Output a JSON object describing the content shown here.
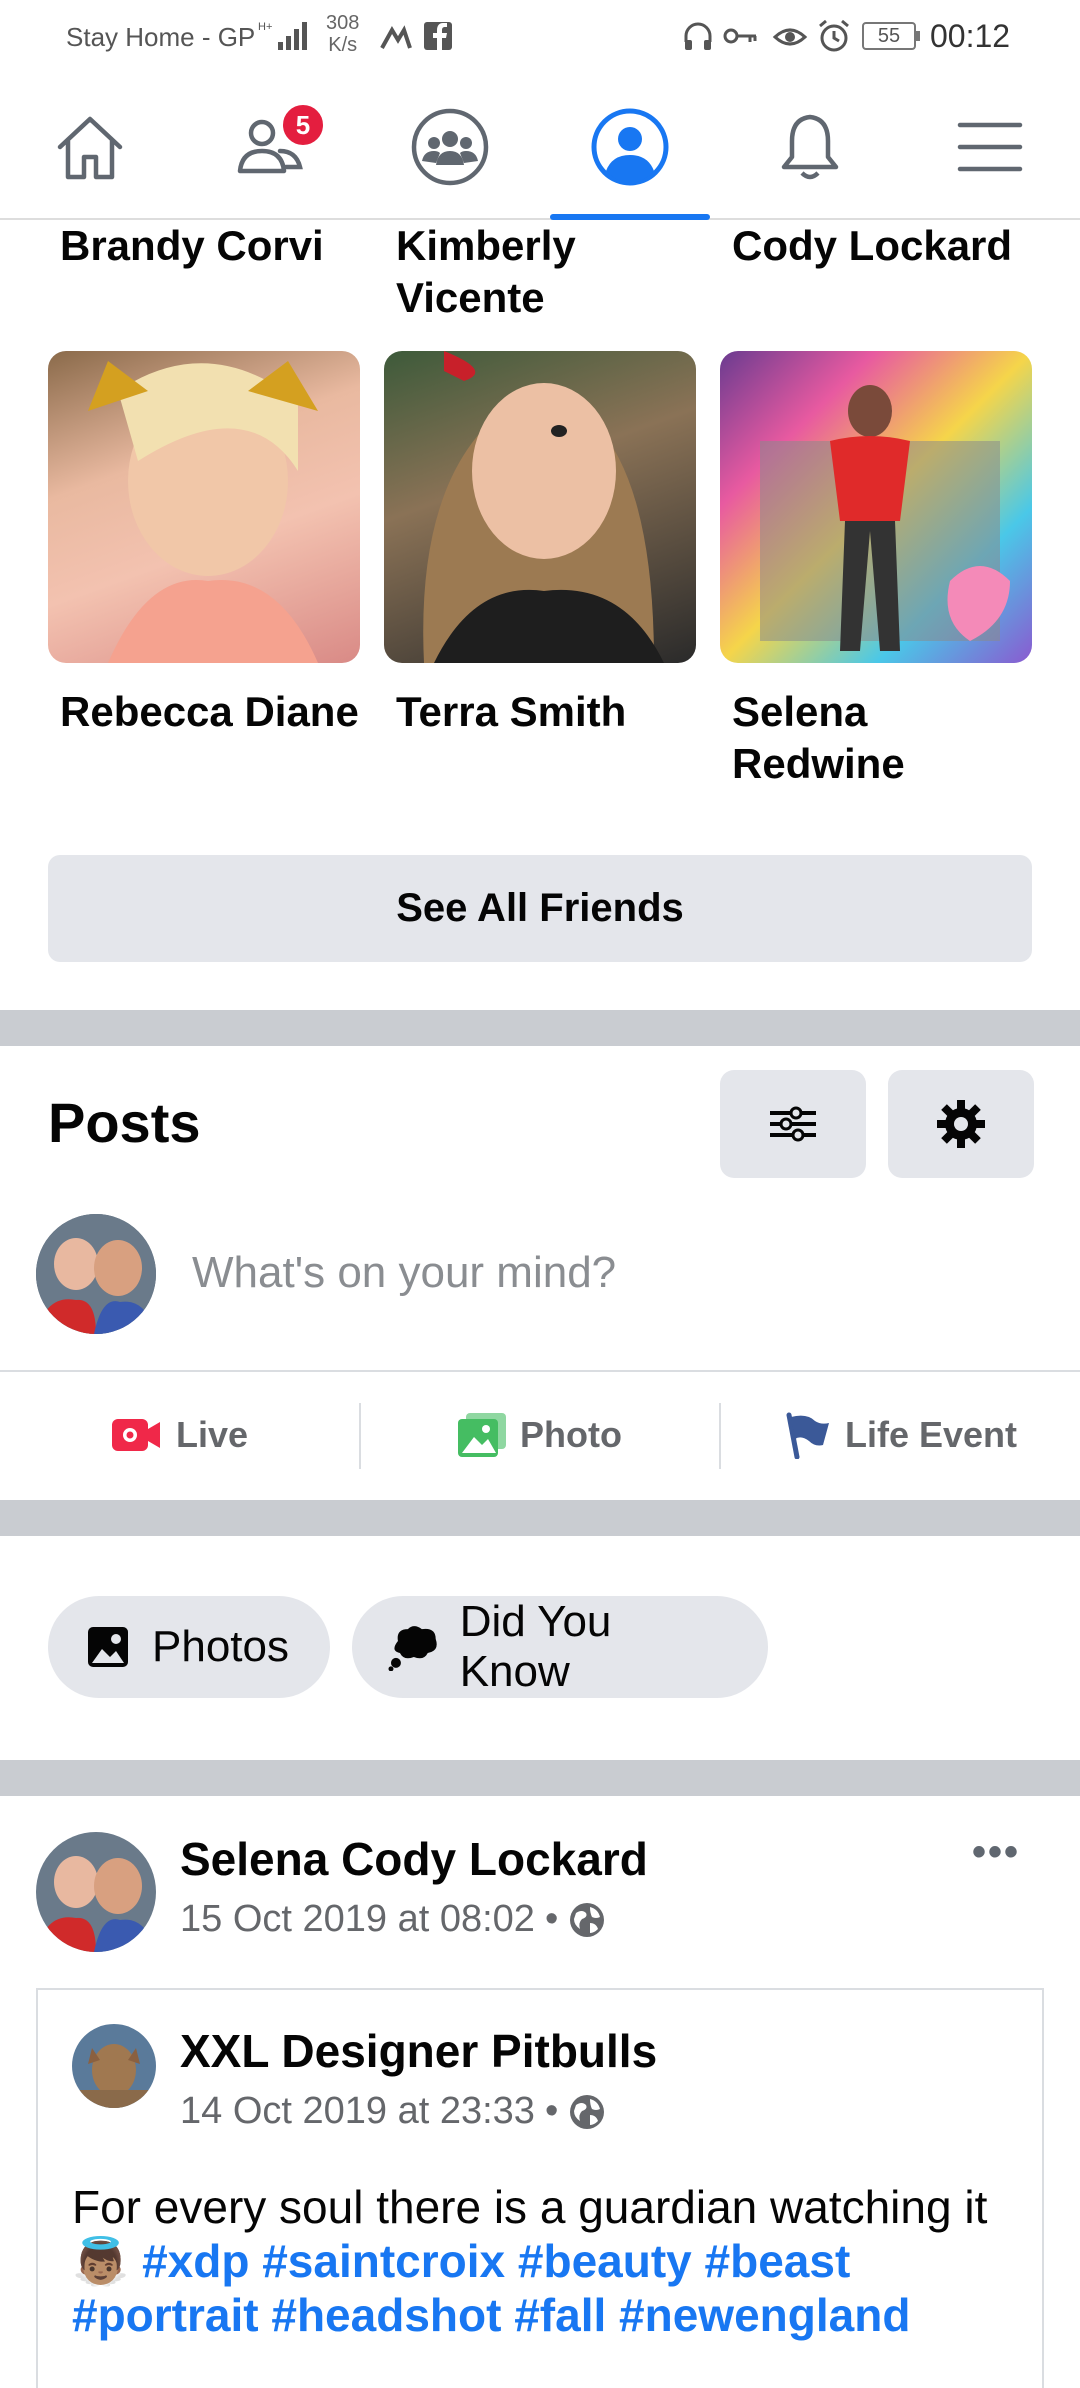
{
  "status_bar": {
    "carrier": "Stay Home - GP",
    "net_speed_value": "308",
    "net_speed_unit": "K/s",
    "battery": "55",
    "time": "00:12"
  },
  "nav": {
    "friends_badge": "5",
    "active_tab": "profile"
  },
  "friends": {
    "row_top_names": [
      "Brandy Corvi",
      "Kimberly Vicente",
      "Cody Lockard"
    ],
    "row_bottom_names": [
      "Rebecca Diane",
      "Terra Smith",
      "Selena Redwine"
    ],
    "see_all_label": "See All Friends"
  },
  "posts": {
    "title": "Posts",
    "composer_placeholder": "What's on your mind?",
    "actions": {
      "live": "Live",
      "photo": "Photo",
      "life_event": "Life Event"
    },
    "chips": {
      "photos": "Photos",
      "did_you_know": "Did You Know"
    }
  },
  "post": {
    "author": "Selena Cody Lockard",
    "date": "15 Oct 2019 at 08:02",
    "more": "•••",
    "shared": {
      "author": "XXL Designer Pitbulls",
      "date": "14 Oct 2019 at 23:33",
      "text_start": "For every soul there is a guardian watching it",
      "emoji": "👼🏽",
      "hashtags": [
        "#xdp",
        "#saintcroix",
        "#beauty",
        "#beast",
        "#portrait",
        "#headshot",
        "#fall",
        "#newengland"
      ]
    }
  },
  "colors": {
    "accent": "#1877f2",
    "badge": "#e41e3f",
    "live": "#f02849",
    "photo": "#45bd62",
    "life_event": "#3b5998"
  }
}
